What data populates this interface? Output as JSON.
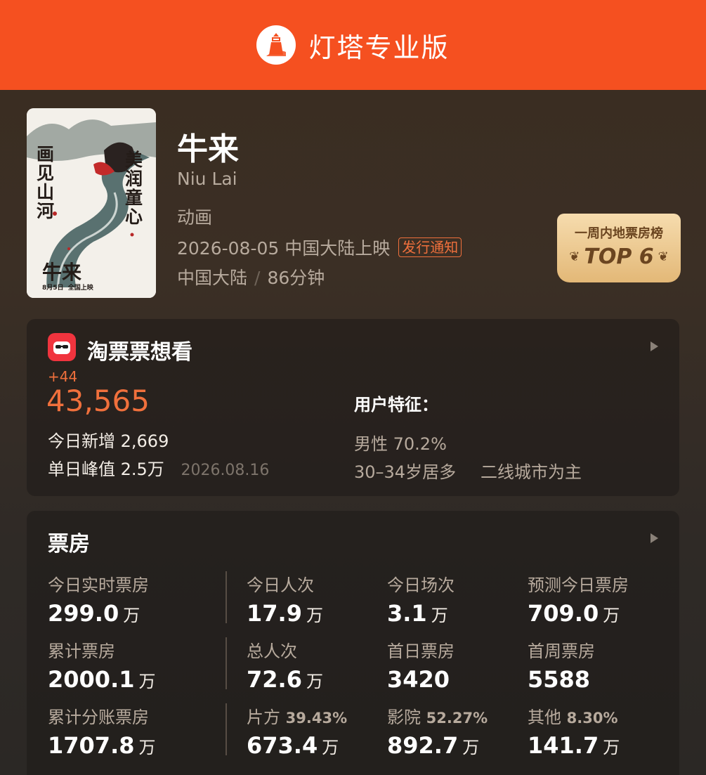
{
  "header": {
    "title": "灯塔专业版"
  },
  "movie": {
    "title": "牛来",
    "english_title": "Niu Lai",
    "genre": "动画",
    "release": "2026-08-05 中国大陆上映",
    "notice_button": "发行通知",
    "region": "中国大陆",
    "separator": "/",
    "duration": "86分钟",
    "poster": {
      "title": "牛来",
      "slogan_left": "画见山河",
      "slogan_right": "美润童心",
      "date": "8月5日  全国上映"
    }
  },
  "rank_badge": {
    "label": "一周内地票房榜",
    "value": "TOP 6"
  },
  "want_to_see": {
    "title": "淘票票想看",
    "delta": "+44",
    "count": "43,565",
    "today_new_label": "今日新增",
    "today_new_value": "2,669",
    "peak_label": "单日峰值",
    "peak_value": "2.5万",
    "peak_date": "2026.08.16",
    "user_features_title": "用户特征：",
    "gender": "男性 70.2%",
    "age": "30–34岁居多",
    "city": "二线城市为主"
  },
  "box_office": {
    "title": "票房",
    "stats": [
      {
        "label": "今日实时票房",
        "value": "299.0",
        "unit": "万"
      },
      {
        "label": "今日人次",
        "value": "17.9",
        "unit": "万"
      },
      {
        "label": "今日场次",
        "value": "3.1",
        "unit": "万"
      },
      {
        "label": "预测今日票房",
        "value": "709.0",
        "unit": "万"
      },
      {
        "label": "累计票房",
        "value": "2000.1",
        "unit": "万"
      },
      {
        "label": "总人次",
        "value": "72.6",
        "unit": "万"
      },
      {
        "label": "首日票房",
        "value": "3420",
        "unit": ""
      },
      {
        "label": "首周票房",
        "value": "5588",
        "unit": ""
      },
      {
        "label": "累计分账票房",
        "value": "1707.8",
        "unit": "万"
      },
      {
        "label": "片方",
        "pct": "39.43%",
        "value": "673.4",
        "unit": "万"
      },
      {
        "label": "影院",
        "pct": "52.27%",
        "value": "892.7",
        "unit": "万"
      },
      {
        "label": "其他",
        "pct": "8.30%",
        "value": "141.7",
        "unit": "万"
      }
    ]
  },
  "colors": {
    "brand": "#f55020",
    "accent": "#f0703c",
    "badge": "#e3b877"
  }
}
